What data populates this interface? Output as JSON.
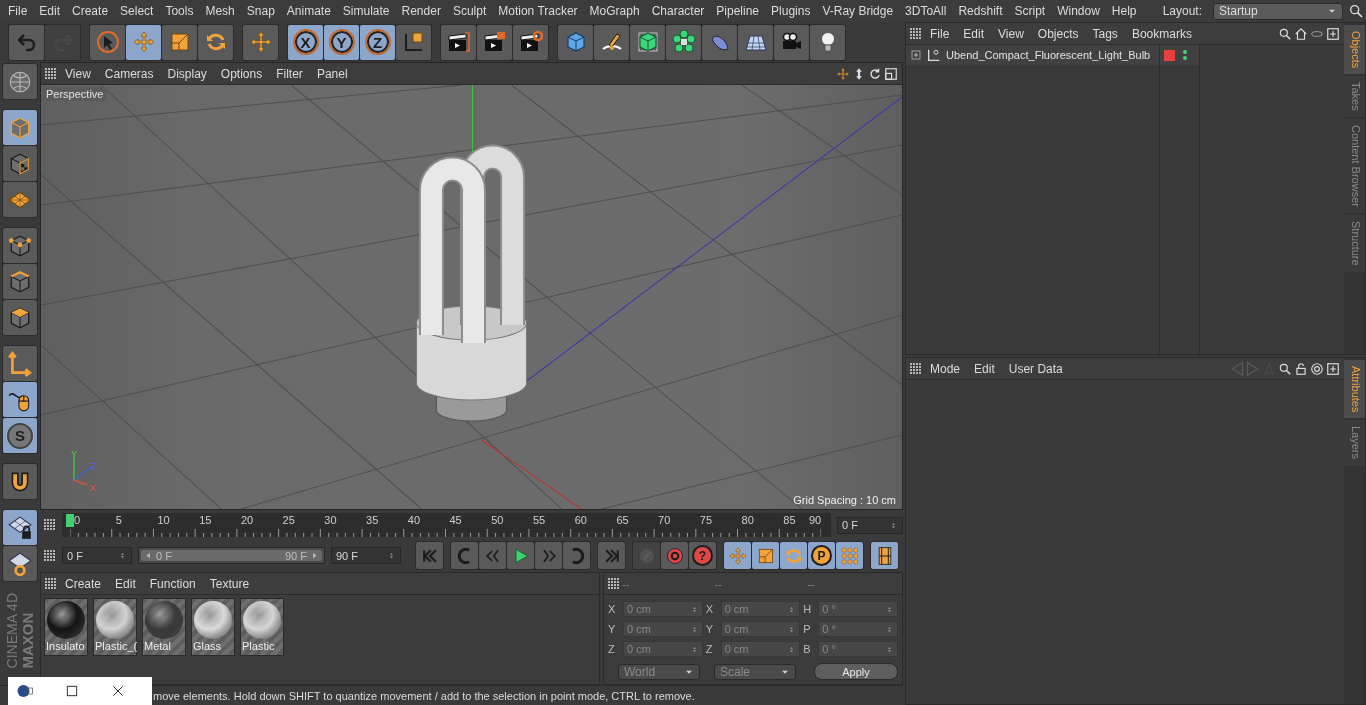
{
  "menu_bar": {
    "items": [
      "File",
      "Edit",
      "Create",
      "Select",
      "Tools",
      "Mesh",
      "Snap",
      "Animate",
      "Simulate",
      "Render",
      "Sculpt",
      "Motion Tracker",
      "MoGraph",
      "Character",
      "Pipeline",
      "Plugins",
      "V-Ray Bridge",
      "3DToAll",
      "Redshift",
      "Script",
      "Window",
      "Help"
    ],
    "layout_label": "Layout:",
    "layout_value": "Startup"
  },
  "toolbar": [
    {
      "kind": "history",
      "items": [
        {
          "selected": false,
          "disabled": false
        },
        {
          "selected": false,
          "disabled": true
        }
      ]
    },
    {
      "kind": "tools",
      "items": [
        {
          "selected": false
        },
        {
          "selected": true
        },
        {
          "selected": false
        },
        {
          "selected": false
        }
      ]
    },
    {
      "kind": "recent",
      "items": [
        {
          "selected": false
        }
      ]
    },
    {
      "kind": "axes",
      "items": [
        {
          "label": "X",
          "selected": true
        },
        {
          "label": "Y",
          "selected": true
        },
        {
          "label": "Z",
          "selected": true
        },
        {
          "selected": false
        }
      ]
    },
    {
      "kind": "render",
      "items": [
        {
          "selected": false
        },
        {
          "selected": false
        },
        {
          "selected": false
        }
      ]
    },
    {
      "kind": "create",
      "items": [
        {
          "selected": false
        },
        {
          "selected": false
        },
        {
          "selected": false
        },
        {
          "selected": false
        },
        {
          "selected": false
        },
        {
          "selected": false
        },
        {
          "selected": false
        },
        {
          "selected": false
        }
      ]
    }
  ],
  "left_toolbar": [
    {
      "items": [
        {
          "selected": false
        }
      ]
    },
    {
      "items": [
        {
          "selected": true
        },
        {
          "selected": false
        },
        {
          "selected": false
        }
      ]
    },
    {
      "items": [
        {
          "selected": false
        },
        {
          "selected": false
        },
        {
          "selected": false
        }
      ]
    },
    {
      "items": [
        {
          "selected": false
        },
        {
          "selected": true
        },
        {
          "selected": true,
          "label": "S"
        }
      ]
    },
    {
      "items": [
        {
          "selected": false
        }
      ]
    },
    {
      "items": [
        {
          "selected": true
        },
        {
          "selected": false
        }
      ]
    }
  ],
  "logo": {
    "brand": "MAXON",
    "product": "CINEMA 4D"
  },
  "viewport": {
    "menus": [
      "View",
      "Cameras",
      "Display",
      "Options",
      "Filter",
      "Panel"
    ],
    "camera_label": "Perspective",
    "grid_label": "Grid Spacing : 10 cm",
    "gizmo_labels": [
      "Y",
      "Z",
      "X"
    ]
  },
  "timeline": {
    "ruler": [
      "0",
      "5",
      "10",
      "15",
      "20",
      "25",
      "30",
      "35",
      "40",
      "45",
      "50",
      "55",
      "60",
      "65",
      "70",
      "75",
      "80",
      "85",
      "90"
    ],
    "playhead": {
      "level": 0
    },
    "current_frame": "0 F",
    "start_field": "0 F",
    "range": {
      "level": 1
    },
    "range_start": "0 F",
    "range_end": "90 F",
    "end_field": "90 F",
    "transport": [
      {
        "selected": false
      },
      {
        "selected": false
      },
      {
        "selected": false
      },
      {
        "selected": false
      },
      {
        "selected": false
      },
      {
        "selected": false
      },
      {
        "selected": false
      }
    ],
    "key_buttons": [
      {
        "disabled": true
      },
      {
        "disabled": false
      },
      {
        "disabled": false,
        "label": "?"
      }
    ],
    "track_buttons": [
      {
        "selected": true
      },
      {
        "selected": true
      },
      {
        "selected": true
      },
      {
        "selected": true,
        "label": "P"
      },
      {
        "selected": true
      }
    ],
    "film_button": {
      "selected": true
    }
  },
  "materials": {
    "menus": [
      "Create",
      "Edit",
      "Function",
      "Texture"
    ],
    "items": [
      {
        "name": "Insulato",
        "color": "#141414"
      },
      {
        "name": "Plastic_(",
        "color": "#d2d2d2"
      },
      {
        "name": "Metal",
        "color": "#3a3a3a"
      },
      {
        "name": "Glass",
        "color": "#dadada"
      },
      {
        "name": "Plastic",
        "color": "#d6d6d6"
      }
    ]
  },
  "coordinates": {
    "headers": [
      "--",
      "--",
      "--"
    ],
    "rows": [
      {
        "labels": [
          "X",
          "X",
          "H"
        ],
        "values": [
          "0 cm",
          "0 cm",
          "0 °"
        ]
      },
      {
        "labels": [
          "Y",
          "Y",
          "P"
        ],
        "values": [
          "0 cm",
          "0 cm",
          "0 °"
        ]
      },
      {
        "labels": [
          "Z",
          "Z",
          "B"
        ],
        "values": [
          "0 cm",
          "0 cm",
          "0 °"
        ]
      }
    ],
    "dropdowns": [
      "World",
      "Scale"
    ],
    "apply": "Apply"
  },
  "status_bar": {
    "text": "move elements. Hold down SHIFT to quantize movement / add to the selection in point mode, CTRL to remove."
  },
  "objects_panel": {
    "menus": [
      "File",
      "Edit",
      "View",
      "Objects",
      "Tags",
      "Bookmarks"
    ],
    "objects": [
      {
        "name": "Ubend_Compact_Fluorescent_Light_Bulb",
        "expanded": false
      }
    ]
  },
  "objects_tabs": [
    {
      "label": "Objects",
      "selected": true
    },
    {
      "label": "Takes",
      "selected": false
    },
    {
      "label": "Content Browser",
      "selected": false
    },
    {
      "label": "Structure",
      "selected": false
    }
  ],
  "attributes_panel": {
    "menus": [
      "Mode",
      "Edit",
      "User Data"
    ]
  },
  "attributes_tabs": [
    {
      "label": "Attributes",
      "selected": true
    },
    {
      "label": "Layers",
      "selected": false
    }
  ]
}
